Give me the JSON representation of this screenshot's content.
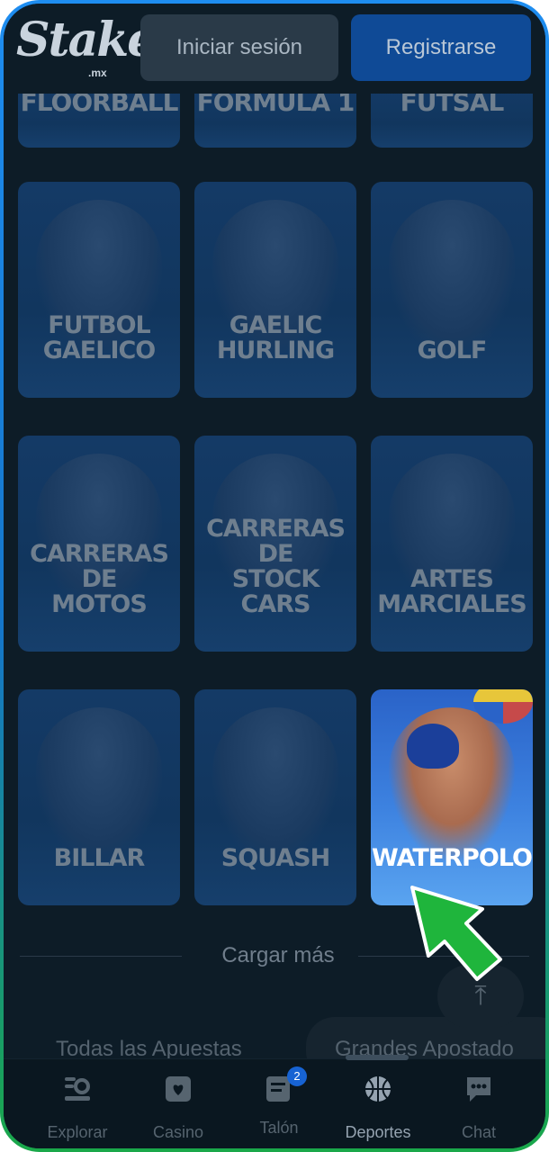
{
  "header": {
    "logo_text": "Stake",
    "logo_sub": ".mx",
    "login_label": "Iniciar sesión",
    "register_label": "Registrarse"
  },
  "sports": {
    "top_row": [
      "FLOORBALL",
      "FORMULA 1",
      "FUTSAL"
    ],
    "cards": [
      {
        "line1": "FUTBOL",
        "line2": "GAELICO"
      },
      {
        "line1": "GAELIC",
        "line2": "HURLING"
      },
      {
        "line1": "GOLF",
        "line2": ""
      },
      {
        "line1": "CARRERAS DE",
        "line2": "MOTOS"
      },
      {
        "line1": "CARRERAS DE",
        "line2": "STOCK CARS"
      },
      {
        "line1": "ARTES",
        "line2": "MARCIALES"
      },
      {
        "line1": "BILLAR",
        "line2": ""
      },
      {
        "line1": "SQUASH",
        "line2": ""
      },
      {
        "line1": "WATERPOLO",
        "line2": ""
      }
    ],
    "highlighted": "WATERPOLO"
  },
  "load_more_label": "Cargar más",
  "bets_tabs": {
    "all": "Todas las Apuestas",
    "high_rollers": "Grandes Apostado"
  },
  "bottom_nav": {
    "explore": "Explorar",
    "casino": "Casino",
    "betslip": "Talón",
    "betslip_badge": "2",
    "sports": "Deportes",
    "chat": "Chat"
  },
  "colors": {
    "background": "#0d1c27",
    "card": "#143a66",
    "active_card": "#3d82e0",
    "pointer": "#1fb53c",
    "badge": "#1763d3"
  }
}
